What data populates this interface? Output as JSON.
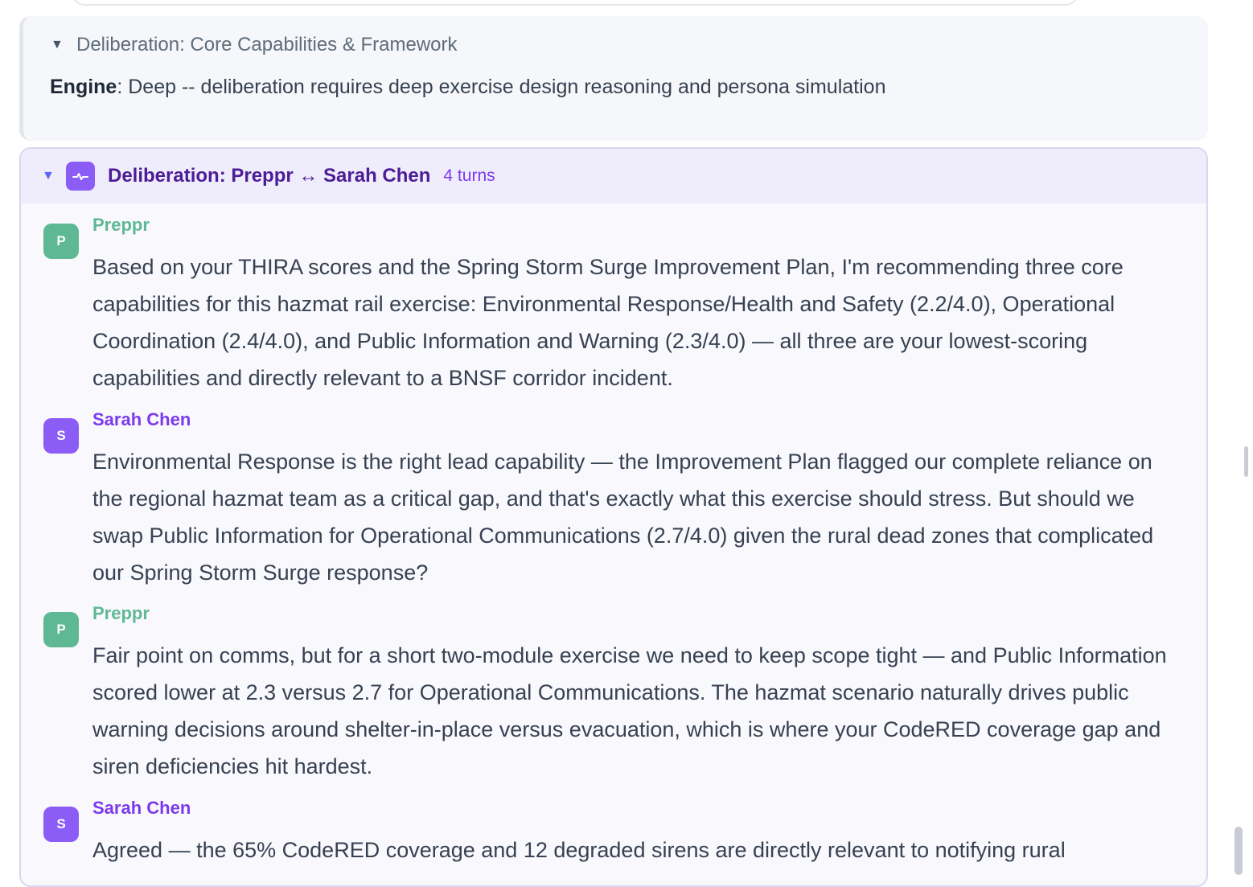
{
  "summary": {
    "title": "Deliberation: Core Capabilities & Framework",
    "toggle": "▼",
    "engine_label": "Engine",
    "engine_text": ": Deep -- deliberation requires deep exercise design reasoning and persona simulation"
  },
  "deliberation": {
    "toggle": "▼",
    "title": "Deliberation: Preppr ↔ Sarah Chen",
    "turns_label": "4 turns",
    "icon": "activity-pulse-icon",
    "messages": [
      {
        "initial": "P",
        "speaker": "Preppr",
        "text": "Based on your THIRA scores and the Spring Storm Surge Improvement Plan, I'm recommending three core capabilities for this hazmat rail exercise: Environmental Response/Health and Safety (2.2/4.0), Operational Coordination (2.4/4.0), and Public Information and Warning (2.3/4.0) — all three are your lowest-scoring capabilities and directly relevant to a BNSF corridor incident."
      },
      {
        "initial": "S",
        "speaker": "Sarah Chen",
        "text": "Environmental Response is the right lead capability — the Improvement Plan flagged our complete reliance on the regional hazmat team as a critical gap, and that's exactly what this exercise should stress. But should we swap Public Information for Operational Communications (2.7/4.0) given the rural dead zones that complicated our Spring Storm Surge response?"
      },
      {
        "initial": "P",
        "speaker": "Preppr",
        "text": "Fair point on comms, but for a short two-module exercise we need to keep scope tight — and Public Information scored lower at 2.3 versus 2.7 for Operational Communications. The hazmat scenario naturally drives public warning decisions around shelter-in-place versus evacuation, which is where your CodeRED coverage gap and siren deficiencies hit hardest."
      },
      {
        "initial": "S",
        "speaker": "Sarah Chen",
        "text": "Agreed — the 65% CodeRED coverage and 12 degraded sirens are directly relevant to notifying rural"
      }
    ]
  },
  "colors": {
    "preppr": "#5fb894",
    "sarah": "#8b5cf6",
    "header_bg": "#efedfc",
    "title": "#4c1d95"
  }
}
